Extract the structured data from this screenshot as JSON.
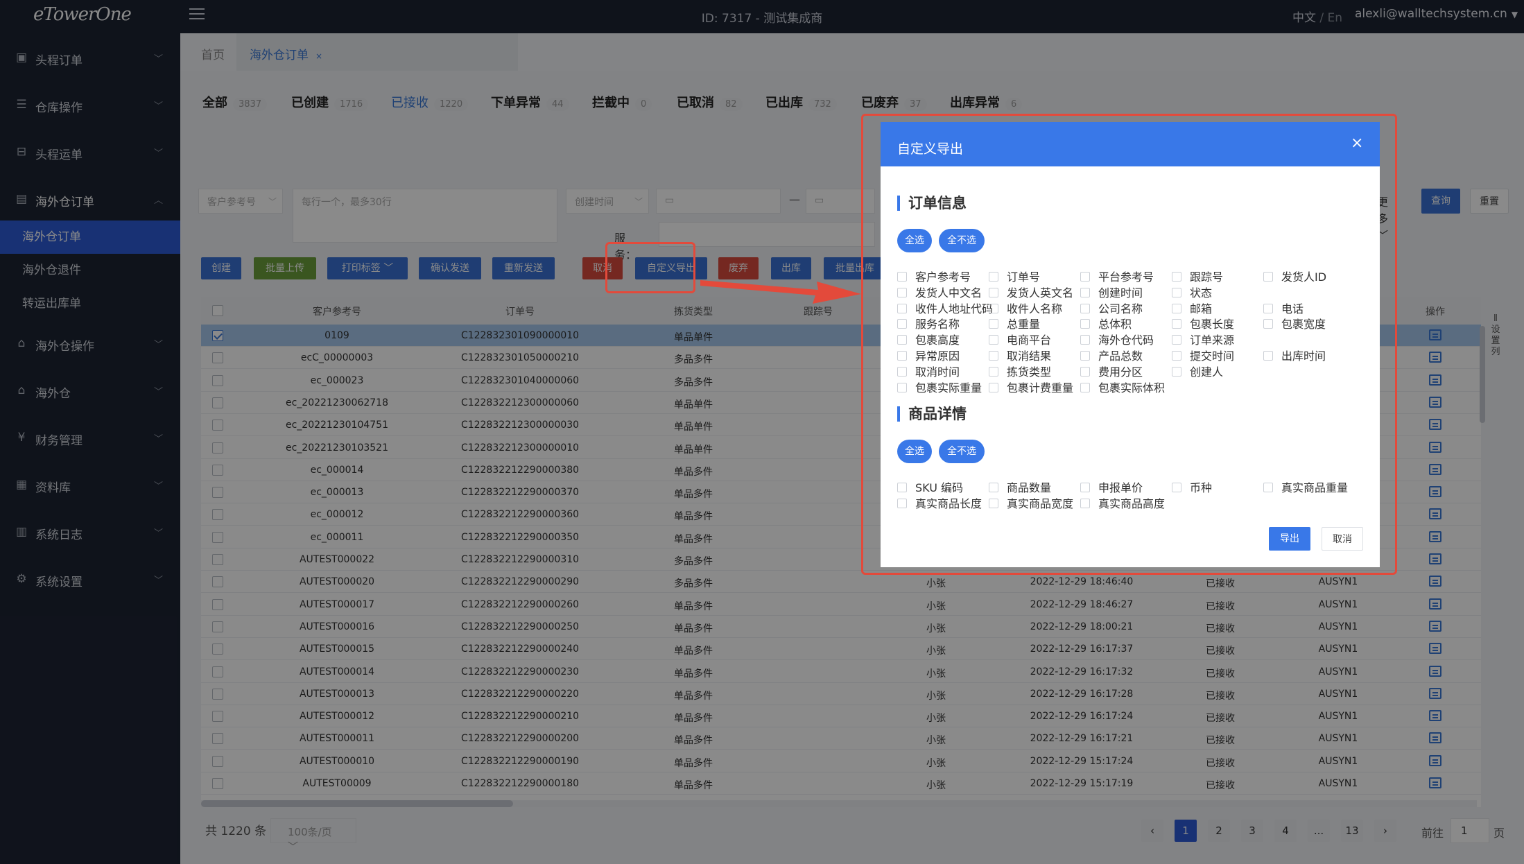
{
  "header": {
    "logo": "eTowerOne",
    "center": "ID: 7317 - 测试集成商",
    "lang_cn": "中文",
    "lang_sep": " / ",
    "lang_en": "En",
    "user": "alexli@walltechsystem.cn"
  },
  "sidebar": {
    "menus": [
      "头程订单",
      "仓库操作",
      "头程运单",
      "海外仓订单",
      "海外仓操作",
      "海外仓",
      "财务管理",
      "资料库",
      "系统日志",
      "系统设置"
    ],
    "subs": [
      "海外仓订单",
      "海外仓退件",
      "转运出库单"
    ]
  },
  "tabs": {
    "home": "首页",
    "current": "海外仓订单",
    "close": "×"
  },
  "status": [
    {
      "label": "全部",
      "count": "3837"
    },
    {
      "label": "已创建",
      "count": "1716"
    },
    {
      "label": "已接收",
      "count": "1220"
    },
    {
      "label": "下单异常",
      "count": "44"
    },
    {
      "label": "拦截中",
      "count": "0"
    },
    {
      "label": "已取消",
      "count": "82"
    },
    {
      "label": "已出库",
      "count": "732"
    },
    {
      "label": "已废弃",
      "count": "37"
    },
    {
      "label": "出库异常",
      "count": "6"
    }
  ],
  "filters": {
    "ref_select": "客户参考号",
    "ref_placeholder": "每行一个，最多30行",
    "time_select": "创建时间",
    "dash": "—",
    "service_label": "服务：",
    "more": "更多",
    "query": "查询",
    "reset": "重置"
  },
  "actions": [
    "创建",
    "批量上传",
    "打印标签",
    "确认发送",
    "重新发送",
    "取消",
    "自定义导出",
    "废弃",
    "出库",
    "批量出库"
  ],
  "table": {
    "headers": [
      "客户参考号",
      "订单号",
      "拣货类型",
      "跟踪号",
      "操作"
    ],
    "rows": [
      {
        "ref": "0109",
        "order": "C122832301090000010",
        "type": "单品单件",
        "name": "",
        "time": "",
        "status": "",
        "code": ""
      },
      {
        "ref": "ecC_00000003",
        "order": "C122832301050000210",
        "type": "多品多件",
        "name": "",
        "time": "",
        "status": "",
        "code": ""
      },
      {
        "ref": "ec_000023",
        "order": "C122832301040000060",
        "type": "多品多件",
        "name": "",
        "time": "",
        "status": "",
        "code": ""
      },
      {
        "ref": "ec_20221230062718",
        "order": "C122832212300000060",
        "type": "单品单件",
        "name": "",
        "time": "",
        "status": "",
        "code": ""
      },
      {
        "ref": "ec_20221230104751",
        "order": "C122832212300000030",
        "type": "单品单件",
        "name": "",
        "time": "",
        "status": "",
        "code": ""
      },
      {
        "ref": "ec_20221230103521",
        "order": "C122832212300000010",
        "type": "单品单件",
        "name": "",
        "time": "",
        "status": "",
        "code": ""
      },
      {
        "ref": "ec_000014",
        "order": "C122832212290000380",
        "type": "单品多件",
        "name": "",
        "time": "",
        "status": "",
        "code": ""
      },
      {
        "ref": "ec_000013",
        "order": "C122832212290000370",
        "type": "单品多件",
        "name": "",
        "time": "",
        "status": "",
        "code": ""
      },
      {
        "ref": "ec_000012",
        "order": "C122832212290000360",
        "type": "单品多件",
        "name": "",
        "time": "",
        "status": "",
        "code": ""
      },
      {
        "ref": "ec_000011",
        "order": "C122832212290000350",
        "type": "单品多件",
        "name": "",
        "time": "",
        "status": "",
        "code": ""
      },
      {
        "ref": "AUTEST000022",
        "order": "C122832212290000310",
        "type": "多品多件",
        "name": "",
        "time": "",
        "status": "",
        "code": ""
      },
      {
        "ref": "AUTEST000020",
        "order": "C122832212290000290",
        "type": "多品多件",
        "name": "小张",
        "time": "2022-12-29 18:46:40",
        "status": "已接收",
        "code": "AUSYN1"
      },
      {
        "ref": "AUTEST000017",
        "order": "C122832212290000260",
        "type": "单品多件",
        "name": "小张",
        "time": "2022-12-29 18:46:27",
        "status": "已接收",
        "code": "AUSYN1"
      },
      {
        "ref": "AUTEST000016",
        "order": "C122832212290000250",
        "type": "单品多件",
        "name": "小张",
        "time": "2022-12-29 18:00:21",
        "status": "已接收",
        "code": "AUSYN1"
      },
      {
        "ref": "AUTEST000015",
        "order": "C122832212290000240",
        "type": "单品多件",
        "name": "小张",
        "time": "2022-12-29 16:17:37",
        "status": "已接收",
        "code": "AUSYN1"
      },
      {
        "ref": "AUTEST000014",
        "order": "C122832212290000230",
        "type": "单品多件",
        "name": "小张",
        "time": "2022-12-29 16:17:32",
        "status": "已接收",
        "code": "AUSYN1"
      },
      {
        "ref": "AUTEST000013",
        "order": "C122832212290000220",
        "type": "单品多件",
        "name": "小张",
        "time": "2022-12-29 16:17:28",
        "status": "已接收",
        "code": "AUSYN1"
      },
      {
        "ref": "AUTEST000012",
        "order": "C122832212290000210",
        "type": "单品多件",
        "name": "小张",
        "time": "2022-12-29 16:17:24",
        "status": "已接收",
        "code": "AUSYN1"
      },
      {
        "ref": "AUTEST000011",
        "order": "C122832212290000200",
        "type": "单品多件",
        "name": "小张",
        "time": "2022-12-29 16:17:21",
        "status": "已接收",
        "code": "AUSYN1"
      },
      {
        "ref": "AUTEST000010",
        "order": "C122832212290000190",
        "type": "单品多件",
        "name": "小张",
        "time": "2022-12-29 15:17:24",
        "status": "已接收",
        "code": "AUSYN1"
      },
      {
        "ref": "AUTEST00009",
        "order": "C122832212290000180",
        "type": "单品多件",
        "name": "小张",
        "time": "2022-12-29 15:17:19",
        "status": "已接收",
        "code": "AUSYN1"
      }
    ],
    "side_setting": [
      "设",
      "置",
      "列"
    ]
  },
  "footer": {
    "total": "共 1220 条",
    "page_size": "100条/页",
    "pages": [
      "1",
      "2",
      "3",
      "4",
      "...",
      "13"
    ],
    "goto_prefix": "前往",
    "goto_value": "1",
    "goto_suffix": "页",
    "prev": "‹",
    "next": "›"
  },
  "modal": {
    "title": "自定义导出",
    "close": "×",
    "sec1": "订单信息",
    "sec2": "商品详情",
    "select_all": "全选",
    "select_none": "全不选",
    "order_fields": [
      [
        "客户参考号",
        "订单号",
        "平台参考号",
        "跟踪号",
        "发货人ID"
      ],
      [
        "发货人中文名",
        "发货人英文名",
        "创建时间",
        "状态"
      ],
      [
        "收件人地址代码",
        "收件人名称",
        "公司名称",
        "邮箱",
        "电话"
      ],
      [
        "服务名称",
        "总重量",
        "总体积",
        "包裹长度",
        "包裹宽度"
      ],
      [
        "包裹高度",
        "电商平台",
        "海外仓代码",
        "订单来源"
      ],
      [
        "异常原因",
        "取消结果",
        "产品总数",
        "提交时间",
        "出库时间"
      ],
      [
        "取消时间",
        "拣货类型",
        "费用分区",
        "创建人"
      ],
      [
        "包裹实际重量",
        "包裹计费重量",
        "包裹实际体积"
      ]
    ],
    "goods_fields": [
      [
        "SKU 编码",
        "商品数量",
        "申报单价",
        "币种",
        "真实商品重量"
      ],
      [
        "真实商品长度",
        "真实商品宽度",
        "真实商品高度"
      ]
    ],
    "export": "导出",
    "cancel": "取消"
  },
  "colors": {
    "primary": "#3978e8",
    "sidebar": "#1d2433",
    "active_menu": "#2e5bd7",
    "highlight": "#e34a3b"
  }
}
